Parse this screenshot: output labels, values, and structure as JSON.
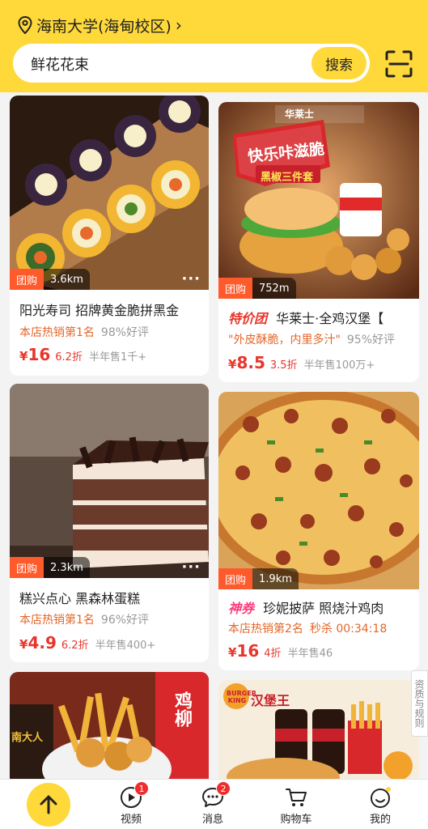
{
  "header": {
    "location": "海南大学(海甸校区)",
    "search_query": "鲜花花束",
    "search_button": "搜索"
  },
  "cards": [
    {
      "tag": "团购",
      "distance": "3.6km",
      "title": "阳光寿司 招牌黄金脆拼黑金",
      "rank": "本店热销第1名",
      "rating": "98%好评",
      "currency": "¥",
      "price": "16",
      "discount": "6.2折",
      "sold": "半年售1千+"
    },
    {
      "tag": "团购",
      "distance": "752m",
      "badge": "特价团",
      "title": "华莱士·全鸡汉堡【",
      "quote": "\"外皮酥脆，内里多汁\"",
      "rating": "95%好评",
      "currency": "¥",
      "price": "8.5",
      "discount": "3.5折",
      "sold": "半年售100万+",
      "poster_text": "快乐咔滋脆",
      "poster_sub": "黑椒三件套",
      "brand": "华莱士"
    },
    {
      "tag": "团购",
      "distance": "2.3km",
      "title": "糕兴点心 黑森林蛋糕",
      "rank": "本店热销第1名",
      "rating": "96%好评",
      "currency": "¥",
      "price": "4.9",
      "discount": "6.2折",
      "sold": "半年售400+"
    },
    {
      "tag": "团购",
      "distance": "1.9km",
      "badge": "神券",
      "title": "珍妮披萨 照烧汁鸡肉",
      "rank": "本店热销第2名",
      "flash": "秒杀 00:34:18",
      "currency": "¥",
      "price": "16",
      "discount": "4折",
      "sold": "半年售46"
    },
    {
      "brand_left": "鸡柳",
      "sign": "南大人"
    },
    {
      "brand": "汉堡王",
      "logo": "BURGER KING"
    }
  ],
  "side_tab": "资质与规则",
  "nav": {
    "items": [
      {
        "label": "视频",
        "badge": "1"
      },
      {
        "label": "消息",
        "badge": "2"
      },
      {
        "label": "购物车"
      },
      {
        "label": "我的"
      }
    ]
  },
  "colors": {
    "accent": "#ffd83a",
    "price": "#e8352b",
    "tag": "#ff5a2c"
  }
}
